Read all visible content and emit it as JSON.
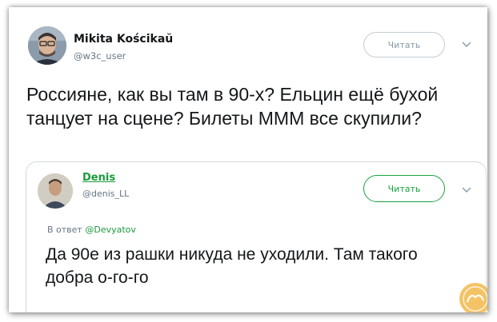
{
  "main_tweet": {
    "name": "Mikita Kościkaŭ",
    "handle": "@w3c_user",
    "follow_label": "Читать",
    "text": "Россияне, как вы там в 90-х? Ельцин ещё бухой танцует на сцене? Билеты МММ все скупили?"
  },
  "quoted_tweet": {
    "name": "Denis",
    "handle": "@denis_LL",
    "follow_label": "Читать",
    "reply_prefix": "В ответ ",
    "reply_mention": "@Devyatov",
    "text": "Да 90е из рашки никуда не уходили. Там такого добра о-го-го"
  },
  "colors": {
    "accent_green": "#17a23f",
    "watermark": "#e6a93a"
  },
  "icons": {
    "menu": "chevron-down-icon",
    "watermark": "site-logo"
  }
}
